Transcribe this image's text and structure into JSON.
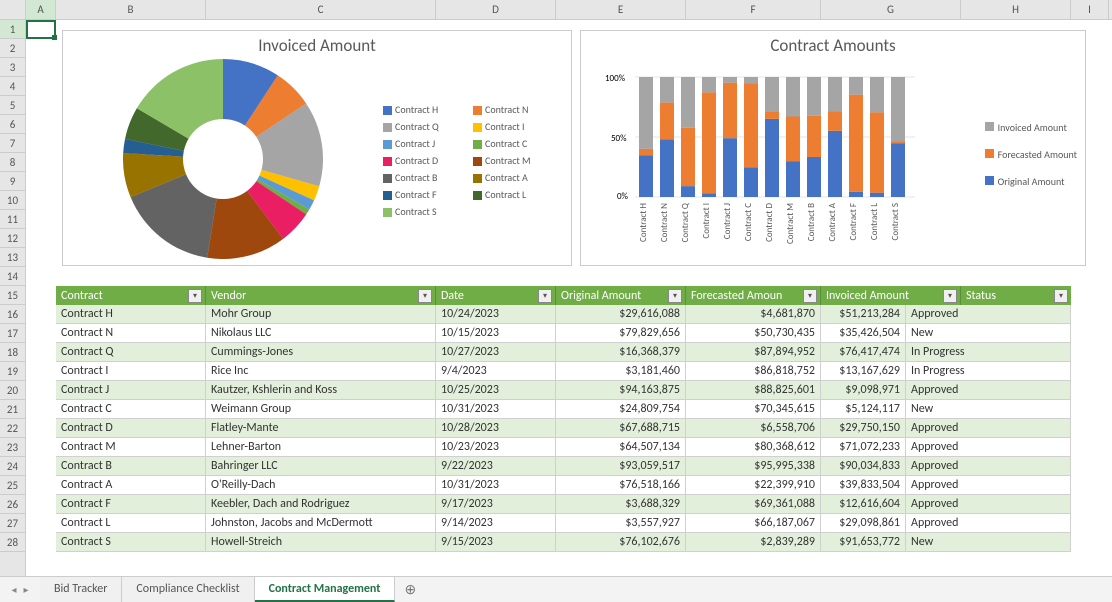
{
  "columns": [
    "A",
    "B",
    "C",
    "D",
    "E",
    "F",
    "G",
    "H",
    "I"
  ],
  "row_start": 1,
  "row_end": 28,
  "selected_cell": "A1",
  "chart1": {
    "title": "Invoiced Amount",
    "legend": [
      {
        "label": "Contract H",
        "color": "#4472C4"
      },
      {
        "label": "Contract N",
        "color": "#ED7D31"
      },
      {
        "label": "Contract Q",
        "color": "#A5A5A5"
      },
      {
        "label": "Contract I",
        "color": "#FFC000"
      },
      {
        "label": "Contract J",
        "color": "#5B9BD5"
      },
      {
        "label": "Contract C",
        "color": "#70AD47"
      },
      {
        "label": "Contract D",
        "color": "#E91E63"
      },
      {
        "label": "Contract M",
        "color": "#9E480E"
      },
      {
        "label": "Contract B",
        "color": "#636363"
      },
      {
        "label": "Contract A",
        "color": "#997300"
      },
      {
        "label": "Contract F",
        "color": "#255E91"
      },
      {
        "label": "Contract L",
        "color": "#43682B"
      },
      {
        "label": "Contract S",
        "color": "#8CC168"
      }
    ]
  },
  "chart2": {
    "title": "Contract Amounts",
    "y_ticks": [
      "0%",
      "50%",
      "100%"
    ],
    "legend": [
      {
        "label": "Invoiced Amount",
        "color": "#A5A5A5"
      },
      {
        "label": "Forecasted Amount",
        "color": "#ED7D31"
      },
      {
        "label": "Original Amount",
        "color": "#4472C4"
      }
    ],
    "categories": [
      "Contract H",
      "Contract N",
      "Contract Q",
      "Contract I",
      "Contract J",
      "Contract C",
      "Contract D",
      "Contract M",
      "Contract B",
      "Contract A",
      "Contract F",
      "Contract L",
      "Contract S"
    ]
  },
  "chart_data": [
    {
      "type": "pie",
      "title": "Invoiced Amount",
      "series": [
        {
          "name": "Invoiced Amount",
          "values": [
            51213284,
            35426504,
            76417474,
            13167629,
            9098971,
            5124117,
            29750150,
            71072233,
            90034833,
            39833504,
            12616604,
            29098861,
            91653772
          ]
        }
      ],
      "categories": [
        "Contract H",
        "Contract N",
        "Contract Q",
        "Contract I",
        "Contract J",
        "Contract C",
        "Contract D",
        "Contract M",
        "Contract B",
        "Contract A",
        "Contract F",
        "Contract L",
        "Contract S"
      ]
    },
    {
      "type": "bar",
      "title": "Contract Amounts",
      "stacked": "percent",
      "categories": [
        "Contract H",
        "Contract N",
        "Contract Q",
        "Contract I",
        "Contract J",
        "Contract C",
        "Contract D",
        "Contract M",
        "Contract B",
        "Contract A",
        "Contract F",
        "Contract L",
        "Contract S"
      ],
      "series": [
        {
          "name": "Original Amount",
          "values": [
            29616088,
            79829656,
            16368379,
            3181460,
            94163875,
            24809754,
            67688715,
            64507134,
            93059517,
            76518166,
            3688329,
            3557927,
            76102676
          ]
        },
        {
          "name": "Forecasted Amount",
          "values": [
            4681870,
            50730435,
            87894952,
            86818752,
            88825601,
            70345615,
            6558706,
            80368612,
            95995338,
            22399910,
            69361088,
            66187067,
            2839289
          ]
        },
        {
          "name": "Invoiced Amount",
          "values": [
            51213284,
            35426504,
            76417474,
            13167629,
            9098971,
            5124117,
            29750150,
            71072233,
            90034833,
            39833504,
            12616604,
            29098861,
            91653772
          ]
        }
      ],
      "ylabel": "",
      "ylim": [
        0,
        100
      ]
    }
  ],
  "table": {
    "headers": [
      "Contract",
      "Vendor",
      "Date",
      "Original Amount",
      "Forecasted Amount",
      "Invoiced Amount",
      "Status"
    ],
    "header_display": [
      "Contract",
      "Vendor",
      "Date",
      "Original Amount",
      "Forecasted Amoun",
      "Invoiced Amount",
      "Status"
    ],
    "rows": [
      {
        "contract": "Contract H",
        "vendor": "Mohr Group",
        "date": "10/24/2023",
        "original": "$29,616,088",
        "forecast": "$4,681,870",
        "invoiced": "$51,213,284",
        "status": "Approved"
      },
      {
        "contract": "Contract N",
        "vendor": "Nikolaus LLC",
        "date": "10/15/2023",
        "original": "$79,829,656",
        "forecast": "$50,730,435",
        "invoiced": "$35,426,504",
        "status": "New"
      },
      {
        "contract": "Contract Q",
        "vendor": "Cummings-Jones",
        "date": "10/27/2023",
        "original": "$16,368,379",
        "forecast": "$87,894,952",
        "invoiced": "$76,417,474",
        "status": "In Progress"
      },
      {
        "contract": "Contract I",
        "vendor": "Rice Inc",
        "date": "9/4/2023",
        "original": "$3,181,460",
        "forecast": "$86,818,752",
        "invoiced": "$13,167,629",
        "status": "In Progress"
      },
      {
        "contract": "Contract J",
        "vendor": "Kautzer, Kshlerin and Koss",
        "date": "10/25/2023",
        "original": "$94,163,875",
        "forecast": "$88,825,601",
        "invoiced": "$9,098,971",
        "status": "Approved"
      },
      {
        "contract": "Contract C",
        "vendor": "Weimann Group",
        "date": "10/31/2023",
        "original": "$24,809,754",
        "forecast": "$70,345,615",
        "invoiced": "$5,124,117",
        "status": "New"
      },
      {
        "contract": "Contract D",
        "vendor": "Flatley-Mante",
        "date": "10/28/2023",
        "original": "$67,688,715",
        "forecast": "$6,558,706",
        "invoiced": "$29,750,150",
        "status": "Approved"
      },
      {
        "contract": "Contract M",
        "vendor": "Lehner-Barton",
        "date": "10/23/2023",
        "original": "$64,507,134",
        "forecast": "$80,368,612",
        "invoiced": "$71,072,233",
        "status": "Approved"
      },
      {
        "contract": "Contract B",
        "vendor": "Bahringer LLC",
        "date": "9/22/2023",
        "original": "$93,059,517",
        "forecast": "$95,995,338",
        "invoiced": "$90,034,833",
        "status": "Approved"
      },
      {
        "contract": "Contract A",
        "vendor": "O'Reilly-Dach",
        "date": "10/31/2023",
        "original": "$76,518,166",
        "forecast": "$22,399,910",
        "invoiced": "$39,833,504",
        "status": "Approved"
      },
      {
        "contract": "Contract F",
        "vendor": "Keebler, Dach and Rodriguez",
        "date": "9/17/2023",
        "original": "$3,688,329",
        "forecast": "$69,361,088",
        "invoiced": "$12,616,604",
        "status": "Approved"
      },
      {
        "contract": "Contract L",
        "vendor": "Johnston, Jacobs and McDermott",
        "date": "9/14/2023",
        "original": "$3,557,927",
        "forecast": "$66,187,067",
        "invoiced": "$29,098,861",
        "status": "Approved"
      },
      {
        "contract": "Contract S",
        "vendor": "Howell-Streich",
        "date": "9/15/2023",
        "original": "$76,102,676",
        "forecast": "$2,839,289",
        "invoiced": "$91,653,772",
        "status": "New"
      }
    ]
  },
  "tabs": [
    {
      "label": "Bid Tracker",
      "active": false
    },
    {
      "label": "Compliance Checklist",
      "active": false
    },
    {
      "label": "Contract Management",
      "active": true
    }
  ]
}
